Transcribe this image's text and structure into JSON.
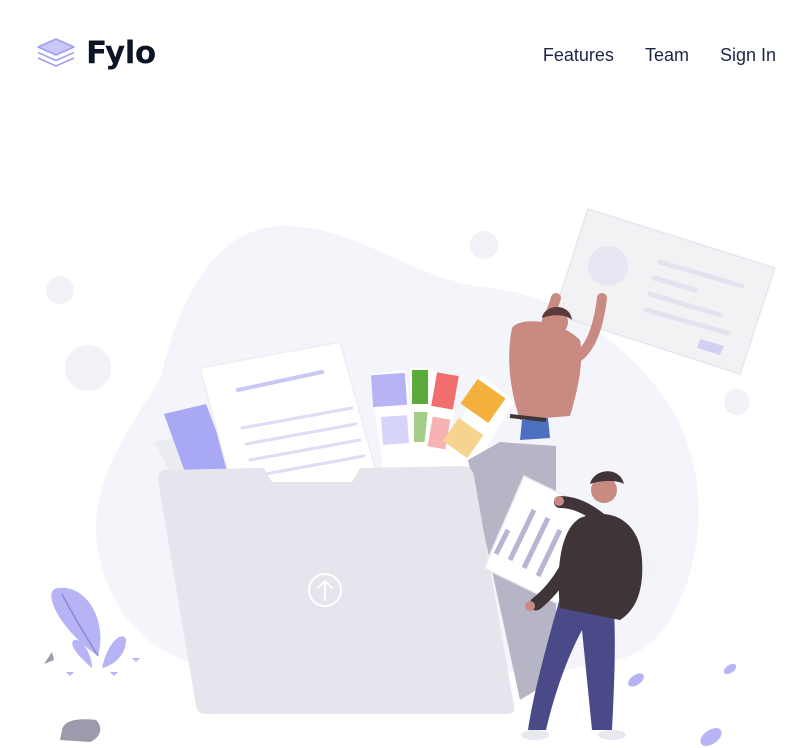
{
  "brand": {
    "name": "Fylo",
    "logo_icon": "stacked-layers-icon",
    "accent_color": "#a2a0f0"
  },
  "nav": {
    "items": [
      {
        "label": "Features"
      },
      {
        "label": "Team"
      },
      {
        "label": "Sign In"
      }
    ]
  },
  "hero": {
    "illustration": "file-upload-illustration",
    "upload_icon": "upload-arrow-icon",
    "colors": {
      "blob": "#f4f4fb",
      "folder": "#e5e6ed",
      "folder_back": "#b5b5c5",
      "accent": "#a9a8f4",
      "jacket": "#3f3438",
      "jeans": "#4a4a89",
      "skin": "#c98a82"
    }
  }
}
